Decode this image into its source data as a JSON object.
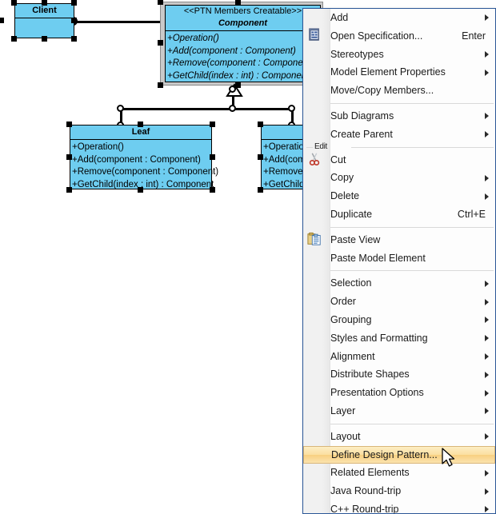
{
  "app": {
    "canvas_background": "#ffffff",
    "class_fill": "#6ECDF0",
    "selection_handle_color": "#000000",
    "menu_border_color": "#2b5797",
    "highlight_color": "#f8d080"
  },
  "diagram": {
    "classes": [
      {
        "id": "client",
        "name": "Client",
        "stereotype": "",
        "operations": [],
        "selected": true,
        "pattern_member": false
      },
      {
        "id": "component",
        "name": "Component",
        "stereotype": "<<PTN Members Creatable>>",
        "operations": [
          "+Operation()",
          "+Add(component : Component)",
          "+Remove(component : Component)",
          "+GetChild(index : int) : Component"
        ],
        "selected": true,
        "pattern_member": true
      },
      {
        "id": "leaf",
        "name": "Leaf",
        "stereotype": "",
        "operations": [
          "+Operation()",
          "+Add(component : Component)",
          "+Remove(component : Component)",
          "+GetChild(index : int) : Component"
        ],
        "selected": true,
        "pattern_member": false
      },
      {
        "id": "composite",
        "name": "",
        "stereotype": "",
        "operations": [
          "+Operation",
          "+Add(com",
          "+Remove",
          "+GetChild"
        ],
        "selected": true,
        "pattern_member": false
      }
    ],
    "relations": [
      {
        "type": "association",
        "from": "client",
        "to": "component"
      },
      {
        "type": "generalization",
        "from": "leaf",
        "to": "component"
      },
      {
        "type": "generalization",
        "from": "composite",
        "to": "component"
      }
    ]
  },
  "context_menu": {
    "sections": [
      {
        "label": "",
        "items": [
          {
            "label": "Add",
            "accel": "",
            "submenu": true,
            "icon": "",
            "selected": false
          },
          {
            "label": "Open Specification...",
            "accel": "Enter",
            "submenu": false,
            "icon": "specification-icon",
            "selected": false
          },
          {
            "label": "Stereotypes",
            "accel": "",
            "submenu": true,
            "icon": "",
            "selected": false
          },
          {
            "label": "Model Element Properties",
            "accel": "",
            "submenu": true,
            "icon": "",
            "selected": false
          },
          {
            "label": "Move/Copy Members...",
            "accel": "",
            "submenu": false,
            "icon": "",
            "selected": false
          }
        ]
      },
      {
        "label": "",
        "items": [
          {
            "label": "Sub Diagrams",
            "accel": "",
            "submenu": true,
            "icon": "",
            "selected": false
          },
          {
            "label": "Create Parent",
            "accel": "",
            "submenu": true,
            "icon": "",
            "selected": false
          }
        ]
      },
      {
        "label": "Edit",
        "items": [
          {
            "label": "Cut",
            "accel": "",
            "submenu": false,
            "icon": "scissors-icon",
            "selected": false
          },
          {
            "label": "Copy",
            "accel": "",
            "submenu": true,
            "icon": "",
            "selected": false
          },
          {
            "label": "Delete",
            "accel": "",
            "submenu": true,
            "icon": "",
            "selected": false
          },
          {
            "label": "Duplicate",
            "accel": "Ctrl+E",
            "submenu": false,
            "icon": "",
            "selected": false
          }
        ]
      },
      {
        "label": "",
        "items": [
          {
            "label": "Paste View",
            "accel": "",
            "submenu": false,
            "icon": "clipboard-icon",
            "selected": false
          },
          {
            "label": "Paste Model Element",
            "accel": "",
            "submenu": false,
            "icon": "",
            "selected": false
          }
        ]
      },
      {
        "label": "",
        "items": [
          {
            "label": "Selection",
            "accel": "",
            "submenu": true,
            "icon": "",
            "selected": false
          },
          {
            "label": "Order",
            "accel": "",
            "submenu": true,
            "icon": "",
            "selected": false
          },
          {
            "label": "Grouping",
            "accel": "",
            "submenu": true,
            "icon": "",
            "selected": false
          },
          {
            "label": "Styles and Formatting",
            "accel": "",
            "submenu": true,
            "icon": "",
            "selected": false
          },
          {
            "label": "Alignment",
            "accel": "",
            "submenu": true,
            "icon": "",
            "selected": false
          },
          {
            "label": "Distribute Shapes",
            "accel": "",
            "submenu": true,
            "icon": "",
            "selected": false
          },
          {
            "label": "Presentation Options",
            "accel": "",
            "submenu": true,
            "icon": "",
            "selected": false
          },
          {
            "label": "Layer",
            "accel": "",
            "submenu": true,
            "icon": "",
            "selected": false
          }
        ]
      },
      {
        "label": "",
        "items": [
          {
            "label": "Layout",
            "accel": "",
            "submenu": true,
            "icon": "",
            "selected": false
          },
          {
            "label": "Define Design Pattern...",
            "accel": "",
            "submenu": false,
            "icon": "",
            "selected": true
          },
          {
            "label": "Related Elements",
            "accel": "",
            "submenu": true,
            "icon": "",
            "selected": false
          },
          {
            "label": "Java Round-trip",
            "accel": "",
            "submenu": true,
            "icon": "",
            "selected": false
          },
          {
            "label": "C++ Round-trip",
            "accel": "",
            "submenu": true,
            "icon": "",
            "selected": false
          }
        ]
      }
    ]
  }
}
